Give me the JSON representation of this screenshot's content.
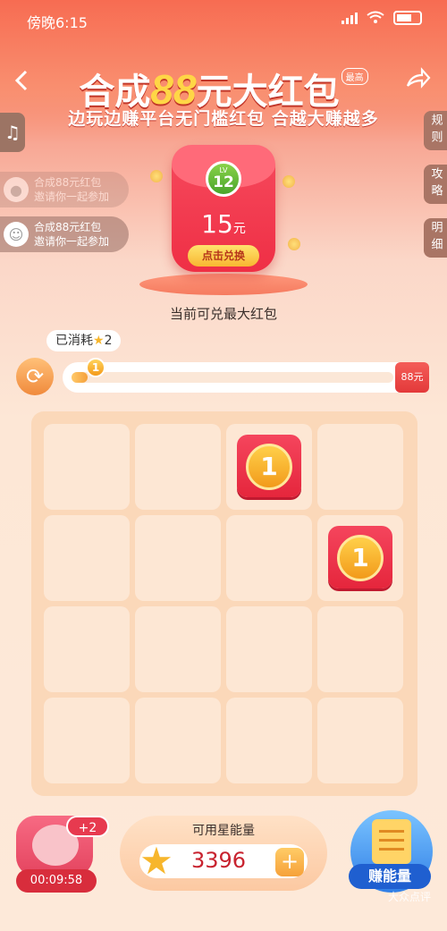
{
  "status": {
    "time": "傍晚6:15"
  },
  "header": {
    "title_prefix": "合成",
    "title_number": "88",
    "title_suffix": "元大红包",
    "title_badge": "最高",
    "subtitle": "边玩边赚平台无门槛红包 合越大赚越多"
  },
  "side_tabs": [
    "规则",
    "攻略",
    "明细"
  ],
  "invites": [
    {
      "title": "合成88元红包",
      "sub": "邀请你一起参加"
    },
    {
      "title": "合成88元红包",
      "sub": "邀请你一起参加"
    }
  ],
  "packet": {
    "level_label": "LV",
    "level": "12",
    "amount": "15",
    "unit": "元",
    "redeem_label": "点击兑换",
    "caption": "当前可兑最大红包"
  },
  "progress": {
    "consumed_label": "已消耗",
    "consumed_value": "2",
    "knob_value": "1",
    "end_label": "88元",
    "fraction": 0.05
  },
  "board": {
    "rows": 4,
    "cols": 4,
    "tiles": [
      {
        "row": 0,
        "col": 2,
        "value": "1"
      },
      {
        "row": 1,
        "col": 3,
        "value": "1"
      }
    ]
  },
  "bottom": {
    "pig_plus": "+2",
    "pig_timer": "00:09:58",
    "energy_label": "可用星能量",
    "energy_value": "3396",
    "add_label": "+",
    "earn_label": "赚能量",
    "watermark": "大众点评"
  },
  "colors": {
    "accent_red": "#e5263c",
    "gold": "#f7b62c"
  }
}
